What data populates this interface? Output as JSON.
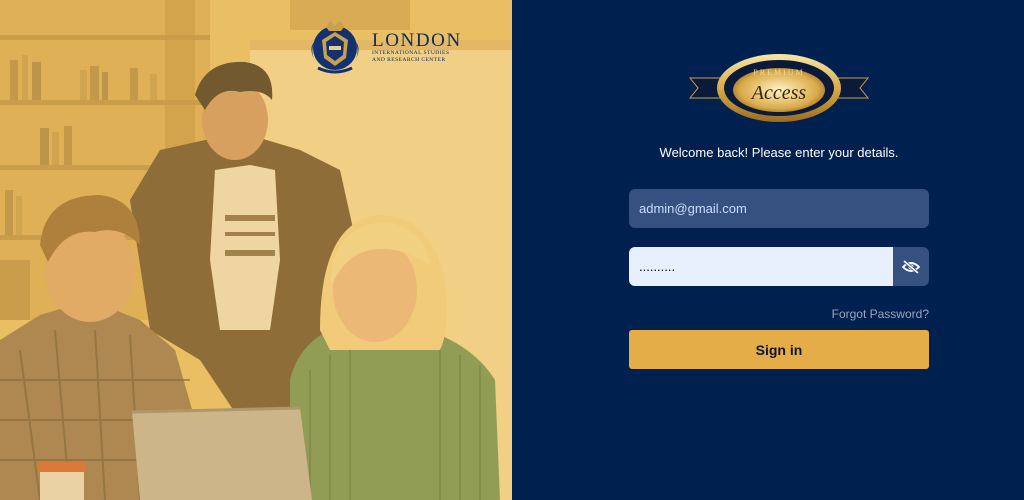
{
  "brand": {
    "name": "LONDON",
    "line1": "INTERNATIONAL STUDIES",
    "line2": "AND RESEARCH CENTER",
    "logo_icon": "crest-icon"
  },
  "hero": {
    "description_icon": "students-photo"
  },
  "badge": {
    "top": "PREMIUM",
    "script": "Access"
  },
  "login": {
    "welcome": "Welcome back! Please enter your details.",
    "email_value": "admin@gmail.com",
    "password_value": "..........",
    "toggle_icon": "eye-off-icon",
    "forgot": "Forgot Password?",
    "submit": "Sign in"
  },
  "colors": {
    "panel": "#00204f",
    "input": "#36517f",
    "accent": "#e4ad48",
    "overlay": "#e8c16b"
  }
}
